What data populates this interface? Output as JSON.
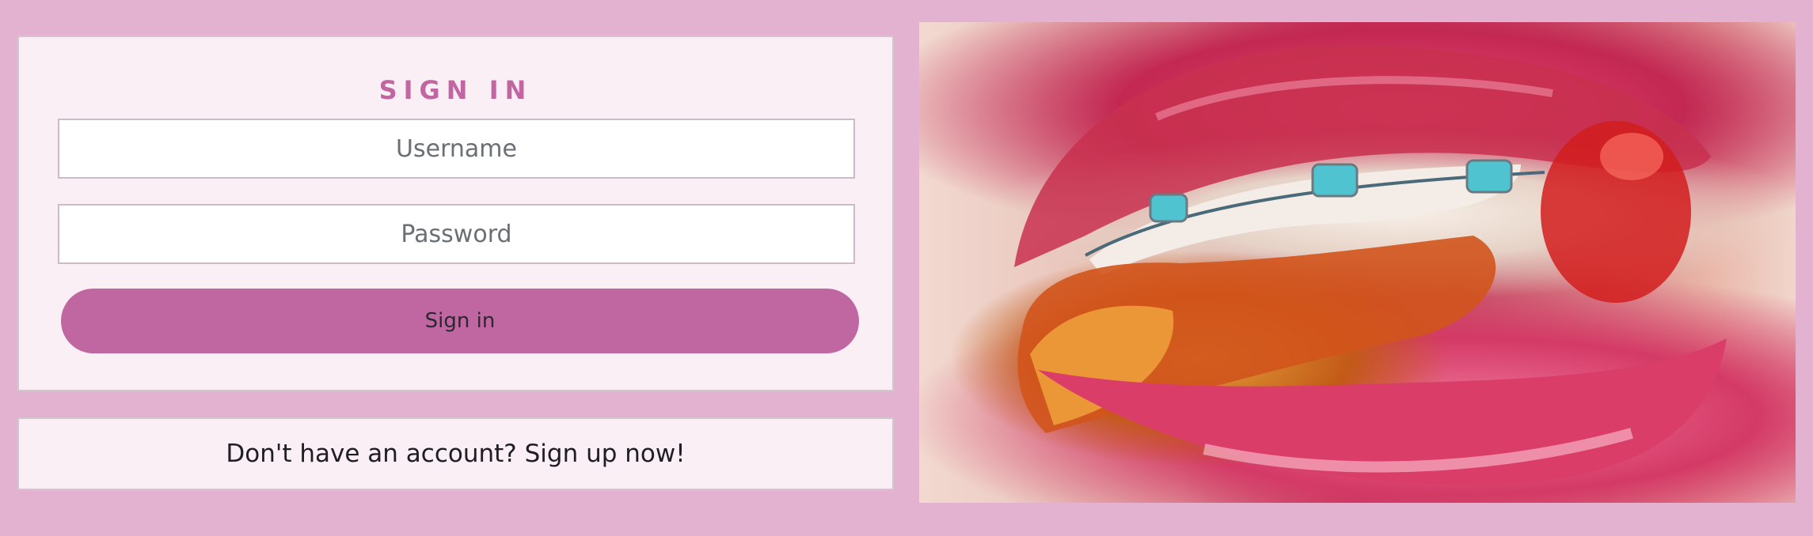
{
  "signin": {
    "title": "SIGN IN",
    "username_placeholder": "Username",
    "password_placeholder": "Password",
    "submit_label": "Sign in"
  },
  "signup": {
    "prompt": "Don't have an account? Sign up now!"
  },
  "colors": {
    "page_background": "#e2b2d0",
    "card_background": "#fbeff6",
    "accent": "#c066a1"
  },
  "hero": {
    "subject": "lips-with-braces-biting-candy-photo"
  }
}
